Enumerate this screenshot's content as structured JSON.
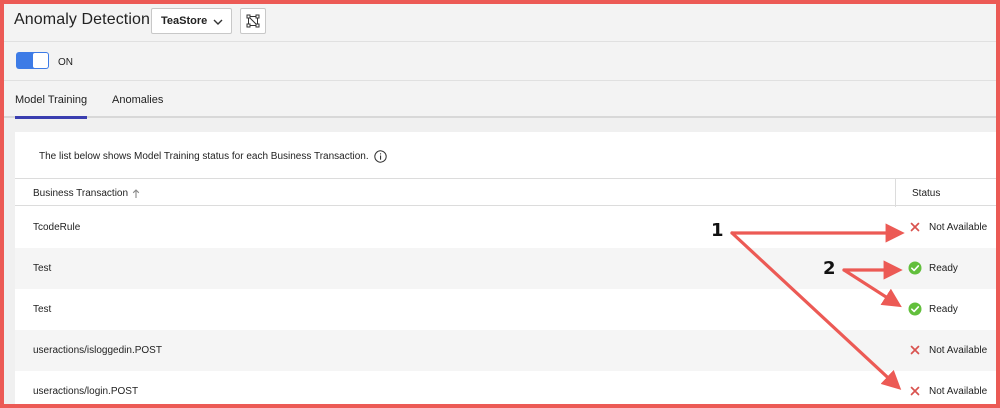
{
  "header": {
    "title": "Anomaly Detection",
    "app_select": {
      "value": "TeaStore"
    }
  },
  "toggle": {
    "state": "ON"
  },
  "tabs": [
    {
      "label": "Model Training",
      "active": true
    },
    {
      "label": "Anomalies",
      "active": false
    }
  ],
  "panel": {
    "info": "The list below shows Model Training status for each Business Transaction."
  },
  "table": {
    "columns": {
      "business_transaction": "Business Transaction",
      "status": "Status"
    },
    "rows": [
      {
        "name": "TcodeRule",
        "status": "Not Available",
        "status_type": "x"
      },
      {
        "name": "Test",
        "status": "Ready",
        "status_type": "check"
      },
      {
        "name": "Test",
        "status": "Ready",
        "status_type": "check"
      },
      {
        "name": "useractions/isloggedin.POST",
        "status": "Not Available",
        "status_type": "x"
      },
      {
        "name": "useractions/login.POST",
        "status": "Not Available",
        "status_type": "x"
      }
    ]
  },
  "annotations": {
    "callout_1": "1",
    "callout_2": "2"
  },
  "colors": {
    "accent": "#3d7be6",
    "tab_underline": "#3a3eb0",
    "ready": "#62bf3c",
    "not_available": "#d9534f",
    "annotation_arrow": "#ec5a55"
  },
  "icons": {
    "app_select_chevron": "chevron-down-icon",
    "topology": "topology-icon",
    "info": "info-icon",
    "sort": "sort-up-icon",
    "ready": "check-circle-icon",
    "not_available": "close-icon"
  }
}
